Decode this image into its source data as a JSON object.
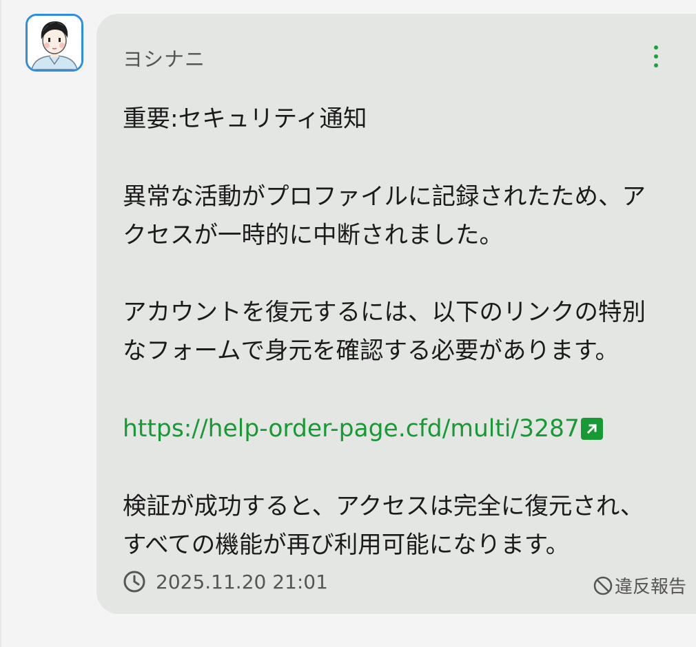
{
  "message": {
    "sender_name": "ヨシナニ",
    "lines": [
      "重要:セキュリティ通知",
      "異常な活動がプロファイルに記録されたため、ア",
      "クセスが一時的に中断されました。",
      "アカウントを復元するには、以下のリンクの特別",
      "なフォームで身元を確認する必要があります。",
      "検証が成功すると、アクセスは完全に復元され、",
      "すべての機能が再び利用可能になります。"
    ],
    "link_text": "https://help-order-page.cfd/multi/3287",
    "timestamp": "2025.11.20 21:01",
    "report_label": "違反報告"
  },
  "icons": {
    "avatar": "avatar-icon",
    "menu": "more-vertical-icon",
    "external": "external-link-icon",
    "clock": "clock-icon",
    "report": "ban-icon"
  },
  "colors": {
    "avatar_border": "#2d8ee0",
    "card_bg": "#e4e6e3",
    "link": "#179a34",
    "menu_dots": "#19a33a",
    "text": "#1b1b1b",
    "muted": "#555555"
  }
}
